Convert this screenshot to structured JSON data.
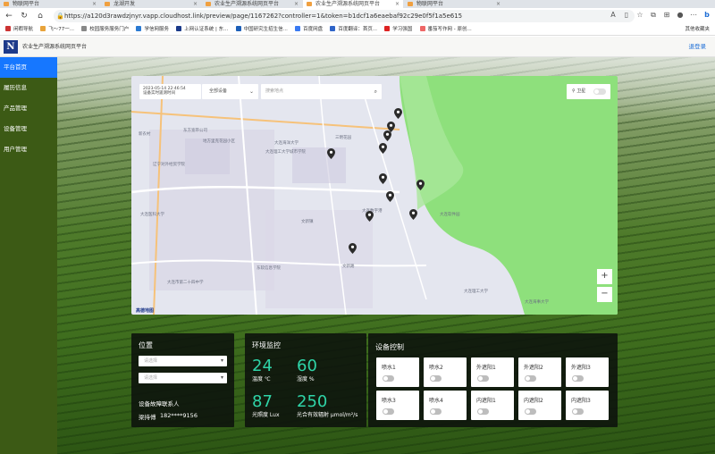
{
  "browser": {
    "tabs": [
      {
        "label": "物联网平台"
      },
      {
        "label": "龙湖开发"
      },
      {
        "label": "农业生产溯源系统网页平台"
      },
      {
        "label": "农业生产溯源系统网页平台"
      },
      {
        "label": "物联网平台"
      }
    ],
    "url": "https://a120d3rawdzjnyr.vapp.cloudhost.link/preview/page/1167262?controller=1&token=b1dcf1a6eaebaf92c29e0f5f1a5e615",
    "bookmarks": [
      "闲暇导航",
      "飞～77一...",
      "校园服务服务门户",
      "学信网服务",
      "上网认证系统 | 东...",
      "中国研究生招生信...",
      "百度网盘",
      "百度翻译：首页...",
      "学习强国",
      "番茄写作网 - 原创..."
    ],
    "bookmarks_right": "其他收藏夹"
  },
  "app": {
    "title": "农业生产溯源系统网页平台",
    "logout": "退登录"
  },
  "sidebar": {
    "items": [
      {
        "label": "平台首页",
        "active": true
      },
      {
        "label": "履历信息",
        "active": false
      },
      {
        "label": "产品管理",
        "active": false
      },
      {
        "label": "设备管理",
        "active": false
      },
      {
        "label": "用户管理",
        "active": false
      }
    ]
  },
  "map": {
    "time_line1": "2023-05-14 22:46:54",
    "time_line2": "设备实时遥测时间",
    "device_select": "全部设备",
    "search_placeholder": "搜索地点",
    "satellite_label": "卫星",
    "zoom_in": "+",
    "zoom_out": "−",
    "attribution": "高德地图",
    "labels": [
      {
        "text": "东方宽带公司"
      },
      {
        "text": "地方里克花园小区"
      },
      {
        "text": "三明花园"
      },
      {
        "text": "新农村"
      },
      {
        "text": "大连海洋大学"
      },
      {
        "text": "辽宁对外经贸学院"
      },
      {
        "text": "大连理工大学城市学院"
      },
      {
        "text": "大连数字港"
      },
      {
        "text": "大连软件园"
      },
      {
        "text": "大连医科大学"
      },
      {
        "text": "大连市第二十四中学"
      },
      {
        "text": "东软信息学院"
      },
      {
        "text": "大连海事大学"
      },
      {
        "text": "文新镇"
      },
      {
        "text": "文新路"
      },
      {
        "text": "大连理工大学"
      }
    ]
  },
  "location": {
    "title": "位置",
    "province_placeholder": "请选择",
    "city_placeholder": "请选择",
    "contact_title": "设备故障联系人",
    "contact_name": "梁持傅",
    "contact_phone": "182****9156"
  },
  "env": {
    "title": "环境监控",
    "metrics": [
      {
        "value": "24",
        "label": "温度 ℃"
      },
      {
        "value": "60",
        "label": "湿度 %"
      },
      {
        "value": "87",
        "label": "光照度 Lux"
      },
      {
        "value": "250",
        "label": "光合有效辐射 μmol/m²/s"
      }
    ]
  },
  "devices": {
    "title": "设备控制",
    "items": [
      {
        "label": "喷水1",
        "on": false
      },
      {
        "label": "喷水2",
        "on": false
      },
      {
        "label": "外遮阳1",
        "on": false
      },
      {
        "label": "外遮阳2",
        "on": false
      },
      {
        "label": "外遮阳3",
        "on": false
      },
      {
        "label": "喷水3",
        "on": false
      },
      {
        "label": "喷水4",
        "on": false
      },
      {
        "label": "内遮阳1",
        "on": false
      },
      {
        "label": "内遮阳2",
        "on": false
      },
      {
        "label": "内遮阳3",
        "on": false
      }
    ]
  },
  "colors": {
    "sidebar_bg": "#3c5a15",
    "active_item": "#1677ff",
    "metric_value": "#2fd4a8",
    "map_green": "#8ee07c"
  }
}
